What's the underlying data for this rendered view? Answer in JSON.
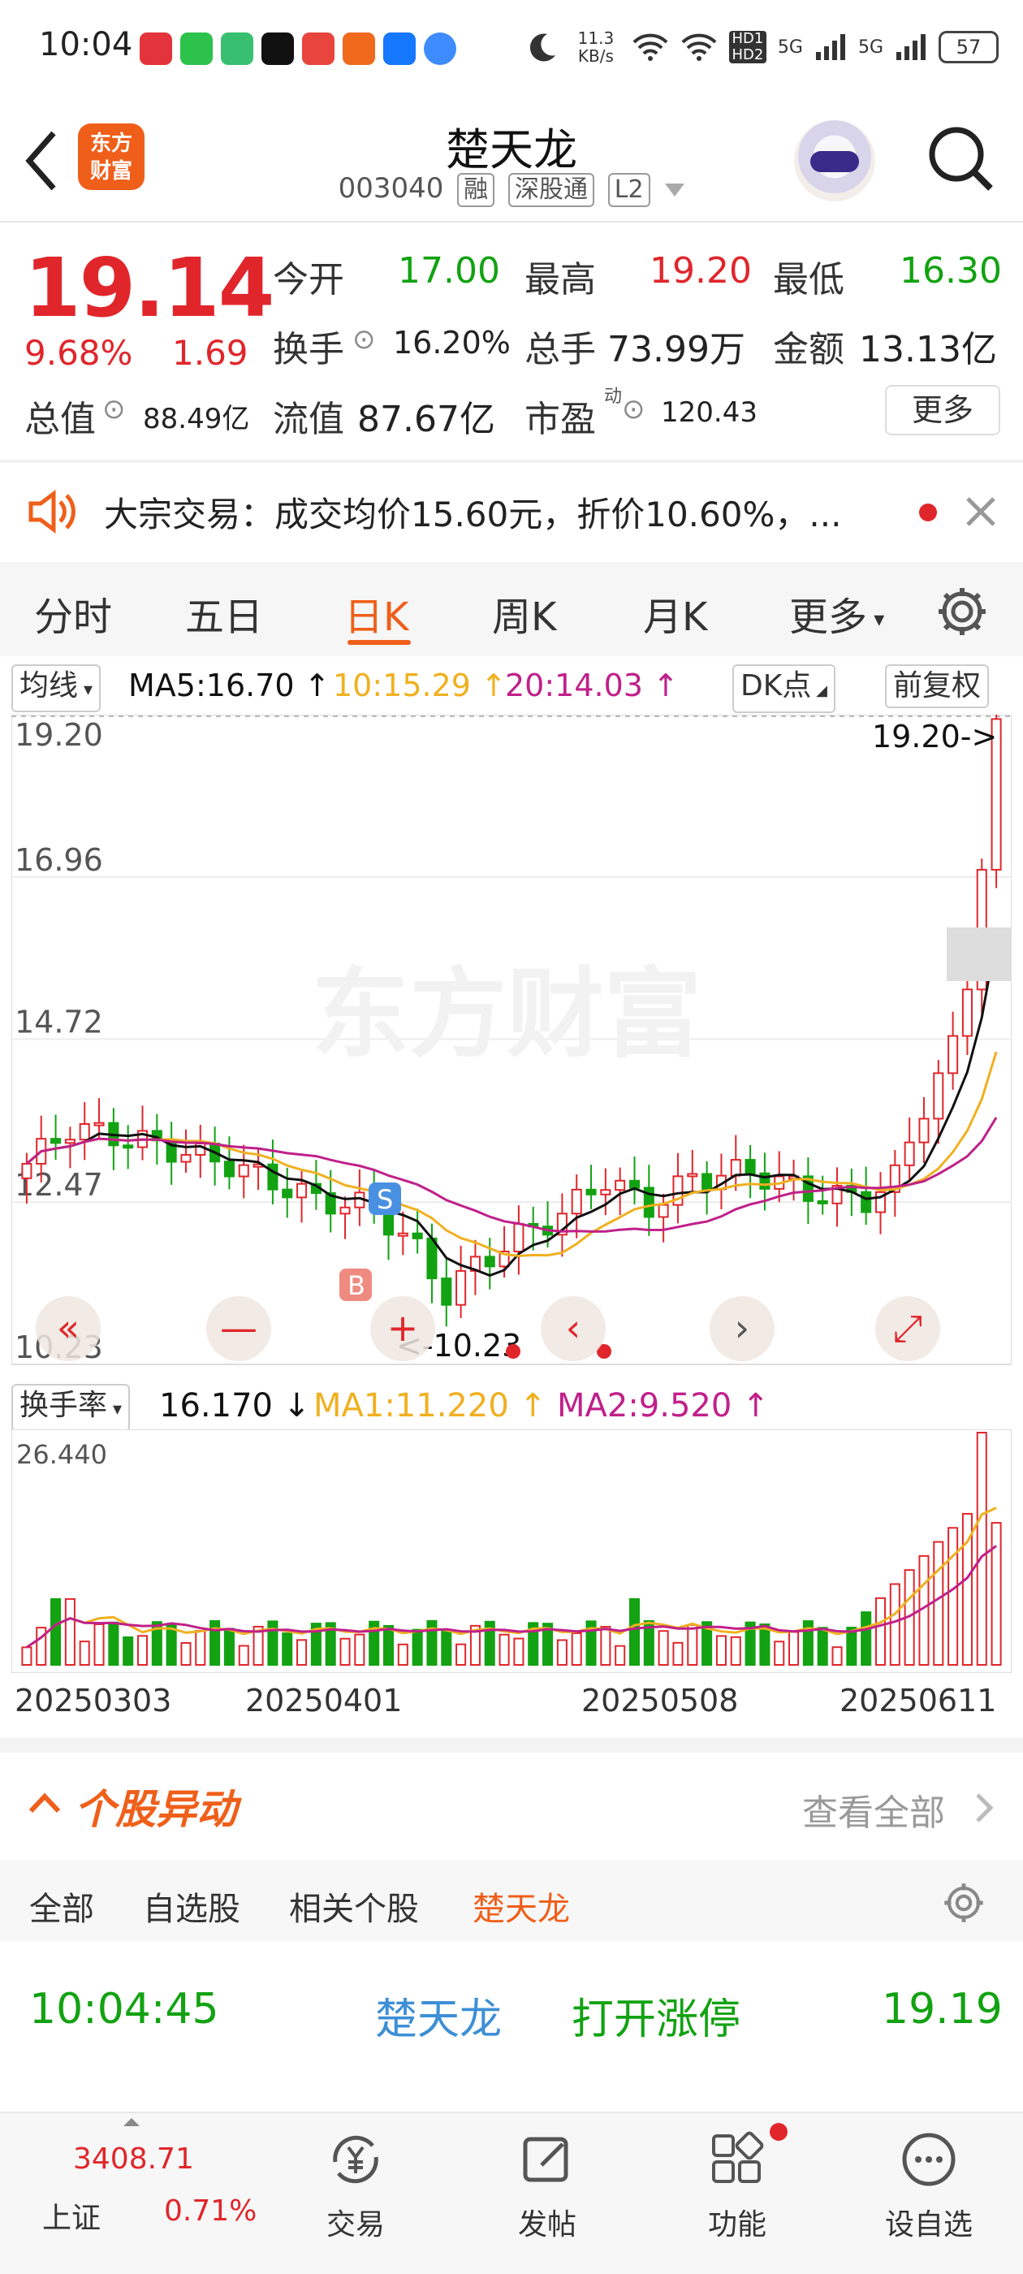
{
  "status_bar": {
    "time": "10:04",
    "net_speed": "11.3 KB/s",
    "hd": "HD1 HD2",
    "signal1": "5G",
    "signal2": "5G",
    "battery": "57",
    "app_icons": [
      "xiaohongshu-icon",
      "wechat-icon",
      "message-icon",
      "tiktok-icon",
      "ting-icon",
      "app-icon",
      "alipay-icon",
      "browser-icon"
    ]
  },
  "header": {
    "back_icon": "chevron-left-icon",
    "logo_text_line1": "东方",
    "logo_text_line2": "财富",
    "title": "楚天龙",
    "code": "003040",
    "tag_rong": "融",
    "tag_sgt": "深股通",
    "tag_l2": "L2",
    "search_icon": "search-icon"
  },
  "quote": {
    "price": "19.14",
    "change_pct": "9.68%",
    "change_amt": "1.69",
    "open_label": "今开",
    "open": "17.00",
    "high_label": "最高",
    "high": "19.20",
    "low_label": "最低",
    "low": "16.30",
    "turnover_label": "换手",
    "turnover": "16.20%",
    "volume_label": "总手",
    "volume": "73.99万",
    "amount_label": "金额",
    "amount": "13.13亿",
    "mktcap_label": "总值",
    "mktcap": "88.49亿",
    "float_label": "流值",
    "float": "87.67亿",
    "pe_label": "市盈",
    "pe_sup": "动",
    "pe": "120.43",
    "more": "更多"
  },
  "notice": {
    "text": "大宗交易：成交均价15.60元，折价10.60%，..."
  },
  "tabs": [
    "分时",
    "五日",
    "日K",
    "周K",
    "月K",
    "更多"
  ],
  "active_tab": 2,
  "ma_legend": {
    "selector": "均线",
    "ma5": "MA5:16.70",
    "ma10": "10:15.29",
    "ma20": "20:14.03",
    "dk": "DK点",
    "adjust": "前复权"
  },
  "vol_legend": {
    "selector": "换手率",
    "value": "16.170",
    "ma1": "MA1:11.220",
    "ma2": "MA2:9.520"
  },
  "chart_data": {
    "type": "candlestick",
    "y_ticks": [
      "19.20",
      "16.96",
      "14.72",
      "12.47",
      "10.23"
    ],
    "ylim": [
      10.23,
      19.2
    ],
    "high_marker": "19.20->",
    "low_marker": "<-10.23",
    "buy_mark": "B",
    "sell_mark": "S",
    "x_ticks": [
      "20250303",
      "20250401",
      "20250508",
      "20250611"
    ],
    "vol_y_tick": "26.440",
    "colors": {
      "up": "#e0262b",
      "down": "#12a212",
      "ma5": "#111111",
      "ma10": "#f0b020",
      "ma20": "#c0208a"
    }
  },
  "abnormal": {
    "title": "个股异动",
    "view_all": "查看全部",
    "tabs": [
      "全部",
      "自选股",
      "相关个股",
      "楚天龙"
    ],
    "active_tab": 3,
    "row": {
      "time": "10:04:45",
      "name": "楚天龙",
      "event": "打开涨停",
      "price": "19.19"
    }
  },
  "bottom_nav": {
    "index_value": "3408.71",
    "index_name": "上证",
    "index_pct": "0.71%",
    "items": [
      "交易",
      "发帖",
      "功能",
      "设自选"
    ]
  }
}
